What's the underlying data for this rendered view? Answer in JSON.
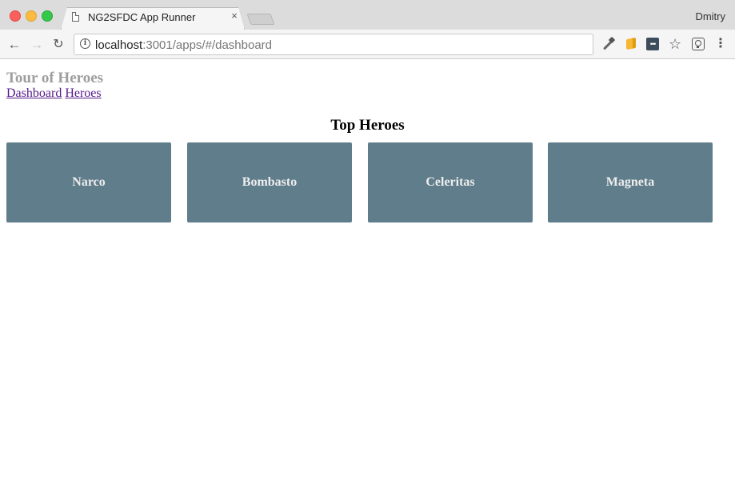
{
  "browser": {
    "tab": {
      "title": "NG2SFDC App Runner",
      "close_glyph": "×"
    },
    "profile_name": "Dmitry",
    "address": {
      "host": "localhost",
      "path": ":3001/apps/#/dashboard"
    },
    "icons": {
      "back": "arrow-left-icon",
      "forward": "arrow-right-icon",
      "reload": "reload-icon",
      "info": "info-icon",
      "eyedropper": "eyedropper-icon",
      "cube": "cube-extension-icon",
      "dots": "dots-extension-icon",
      "star": "star-icon",
      "bulb": "lightbulb-extension-icon",
      "menu": "kebab-menu-icon"
    }
  },
  "app": {
    "title": "Tour of Heroes",
    "nav": [
      {
        "label": "Dashboard"
      },
      {
        "label": "Heroes"
      }
    ],
    "section_title": "Top Heroes",
    "heroes": [
      {
        "name": "Narco"
      },
      {
        "name": "Bombasto"
      },
      {
        "name": "Celeritas"
      },
      {
        "name": "Magneta"
      }
    ],
    "colors": {
      "card_background": "#607d8b",
      "card_text": "#eeeeee",
      "title_color": "#9e9e9e",
      "link_color": "#551a8b"
    }
  }
}
